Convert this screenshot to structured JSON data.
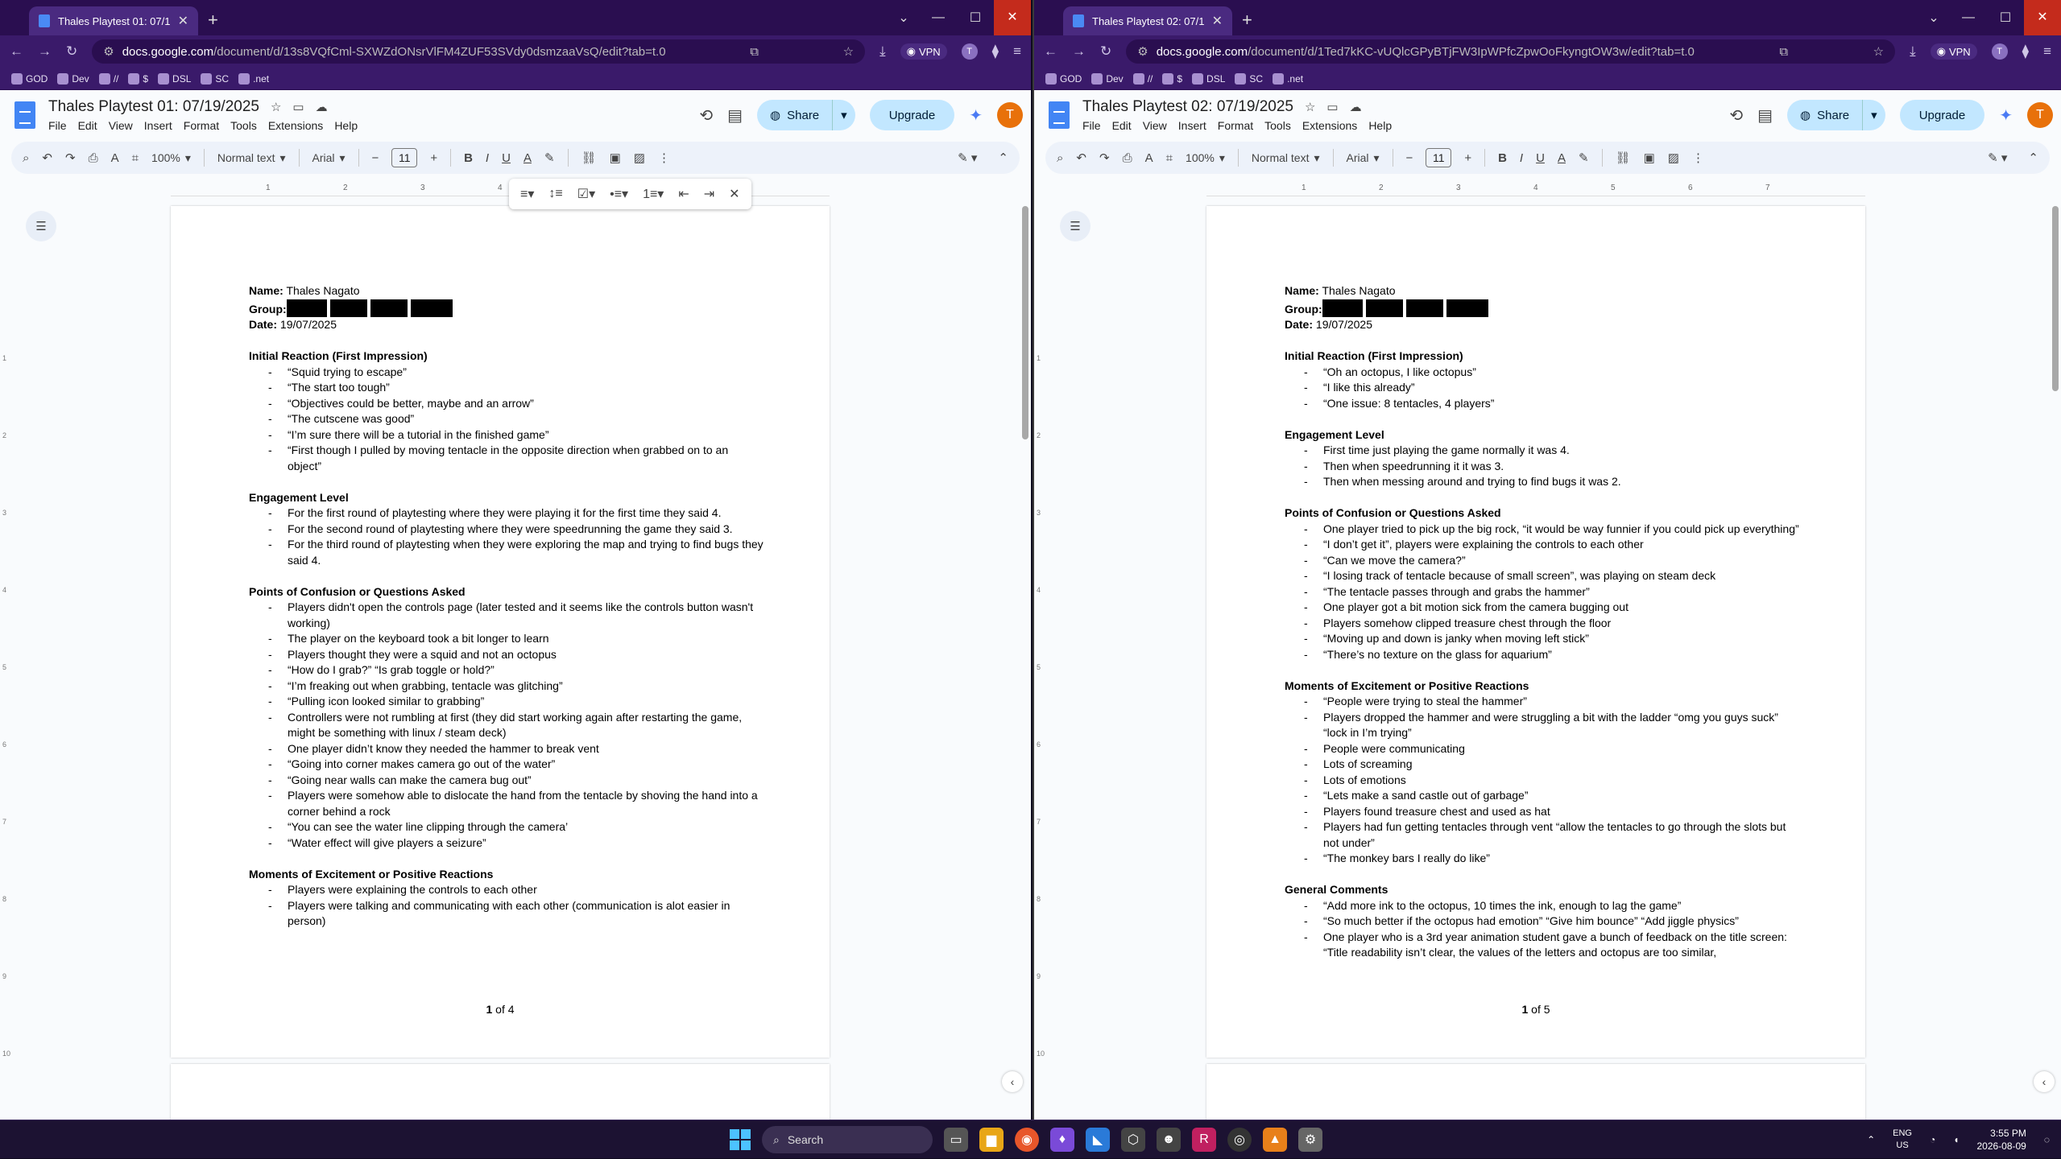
{
  "windows": [
    {
      "tab_title": "Thales Playtest 01: 07/19/2025",
      "url_domain": "docs.google.com",
      "url_path": "/document/d/13s8VQfCml-SXWZdONsrVlFM4ZUF53SVdy0dsmzaaVsQ/edit?tab=t.0",
      "doc_title": "Thales Playtest 01: 07/19/2025",
      "page_number": "1",
      "page_total": "4",
      "sections": [
        {
          "heading": "Initial Reaction (First Impression)",
          "items": [
            "“Squid trying to escape”",
            "“The start too tough”",
            "“Objectives could be better, maybe and an arrow”",
            "“The cutscene was good”",
            "“I’m sure there will be a tutorial in the finished game”",
            "“First though I pulled by moving tentacle in the opposite direction when grabbed on to an object”"
          ]
        },
        {
          "heading": "Engagement Level",
          "items": [
            "For the first round of playtesting where they were playing it for the first time they said 4.",
            "For the second round of playtesting where they were speedrunning the game they said 3.",
            "For the third round of playtesting when they were exploring the map and trying to find bugs they said 4."
          ]
        },
        {
          "heading": "Points of Confusion or Questions Asked",
          "items": [
            "Players didn't open the controls page (later tested and it seems like the controls button wasn't working)",
            "The player on the keyboard took a bit longer to learn",
            "Players thought they were a squid and not an octopus",
            "“How do I grab?” “Is grab toggle or hold?”",
            " “I’m freaking out when grabbing, tentacle was glitching”",
            "“Pulling icon looked similar to grabbing”",
            "Controllers were not rumbling at first (they did start working again after restarting the game, might be something with linux / steam deck)",
            "One player didn’t know they needed the hammer to break vent",
            "“Going into corner makes camera go out of the water”",
            "“Going near walls can make the camera bug out”",
            "Players were somehow able to dislocate the hand from the tentacle by shoving the hand into a corner behind a rock",
            "“You can see the water line clipping through the camera’",
            "“Water effect will give players a seizure”"
          ]
        },
        {
          "heading": "Moments of Excitement or Positive Reactions",
          "items": [
            "Players were explaining the controls to each other",
            "Players were talking and communicating with each other (communication is alot easier in person)"
          ]
        }
      ]
    },
    {
      "tab_title": "Thales Playtest 02: 07/19/2025",
      "url_domain": "docs.google.com",
      "url_path": "/document/d/1Ted7kKC-vUQlcGPyBTjFW3IpWPfcZpwOoFkyngtOW3w/edit?tab=t.0",
      "doc_title": "Thales Playtest 02: 07/19/2025",
      "page_number": "1",
      "page_total": "5",
      "sections": [
        {
          "heading": "Initial Reaction (First Impression)",
          "items": [
            "“Oh an octopus, I like octopus”",
            "“I like this already”",
            "“One issue: 8 tentacles, 4 players”"
          ]
        },
        {
          "heading": "Engagement Level",
          "items": [
            "First time just playing the game normally it was 4.",
            "Then when speedrunning it it was 3.",
            "Then when messing around and trying to find bugs it was 2."
          ]
        },
        {
          "heading": "Points of Confusion or Questions Asked",
          "items": [
            "One player tried to pick up the big rock, “it would be way funnier if you could pick up everything”",
            "“I don’t get it”, players were explaining the controls to each other",
            "“Can we move the camera?”",
            "“I losing track of tentacle because of small screen”, was playing on steam deck",
            "“The tentacle passes through and grabs the hammer”",
            "One player got a bit motion sick from the camera bugging out",
            "Players somehow clipped treasure chest through the floor",
            "“Moving up and down is janky when moving left stick”",
            "“There’s no texture on the glass for aquarium”"
          ]
        },
        {
          "heading": "Moments of Excitement or Positive Reactions",
          "items": [
            "“People were trying to steal the hammer”",
            "Players dropped the hammer and were struggling a bit with the ladder “omg you guys suck” “lock in I’m trying”",
            "People were communicating",
            "Lots of screaming",
            "Lots of emotions",
            "“Lets make a sand castle out of garbage”",
            "Players found treasure chest and used as hat",
            "Players had fun getting tentacles through vent “allow the tentacles to go through the slots but not under”",
            "“The monkey bars I really do like”"
          ]
        },
        {
          "heading": "General Comments",
          "items": [
            "“Add more ink to the octopus, 10 times the ink, enough to lag the game”",
            "“So much better if the octopus had emotion” “Give him bounce” “Add jiggle physics”",
            "One player who is a 3rd year animation student gave a bunch of feedback on the title screen: “Title readability isn’t clear, the values of the letters and octopus are too similar,"
          ]
        }
      ]
    }
  ],
  "doc_fields": {
    "name_label": "Name:",
    "name_value": "Thales Nagato",
    "group_label": "Group:",
    "date_label": "Date:",
    "date_value": "19/07/2025",
    "page_of": "of"
  },
  "menus": [
    "File",
    "Edit",
    "View",
    "Insert",
    "Format",
    "Tools",
    "Extensions",
    "Help"
  ],
  "toolbar": {
    "zoom": "100%",
    "style": "Normal text",
    "font": "Arial",
    "size": "11"
  },
  "buttons": {
    "share": "Share",
    "upgrade": "Upgrade",
    "avatar": "T",
    "vpn": "VPN"
  },
  "bookmarks": [
    "GOD",
    "Dev",
    "//",
    "$",
    "DSL",
    "SC",
    ".net"
  ],
  "taskbar": {
    "search": "Search",
    "lang1": "ENG",
    "lang2": "US",
    "time": "3:55 PM",
    "date": "2026-08-09"
  },
  "colors": {
    "titlebar": "#2a0e50",
    "share_bg": "#c2e7ff",
    "avatar": "#e8710a",
    "docs_blue": "#4285f4"
  }
}
